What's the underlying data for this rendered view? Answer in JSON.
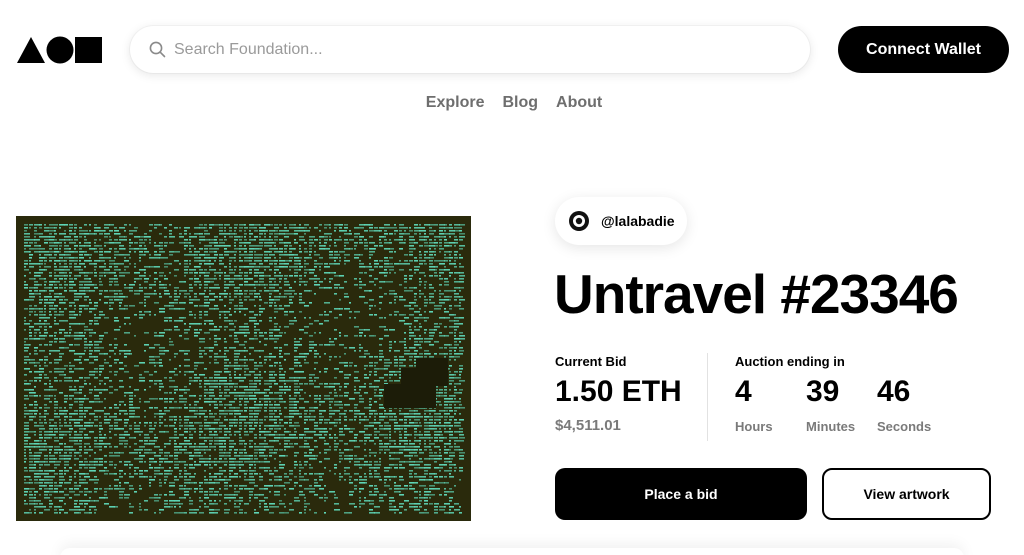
{
  "header": {
    "logo_icon": "foundation-logo-icon",
    "search": {
      "placeholder": "Search Foundation...",
      "icon": "search-icon"
    },
    "connect_wallet_label": "Connect Wallet"
  },
  "nav": {
    "items": [
      "Explore",
      "Blog",
      "About"
    ]
  },
  "artwork": {
    "palette": {
      "background": "#2a2a0c",
      "accent": "#5fd7b8"
    }
  },
  "listing": {
    "creator_handle": "@lalabadie",
    "title": "Untravel #23346",
    "current_bid_label": "Current Bid",
    "current_bid_value": "1.50 ETH",
    "current_bid_usd": "$4,511.01",
    "auction_label": "Auction ending in",
    "countdown": [
      {
        "value": "4",
        "unit": "Hours"
      },
      {
        "value": "39",
        "unit": "Minutes"
      },
      {
        "value": "46",
        "unit": "Seconds"
      }
    ],
    "place_bid_label": "Place a bid",
    "view_artwork_label": "View artwork"
  }
}
